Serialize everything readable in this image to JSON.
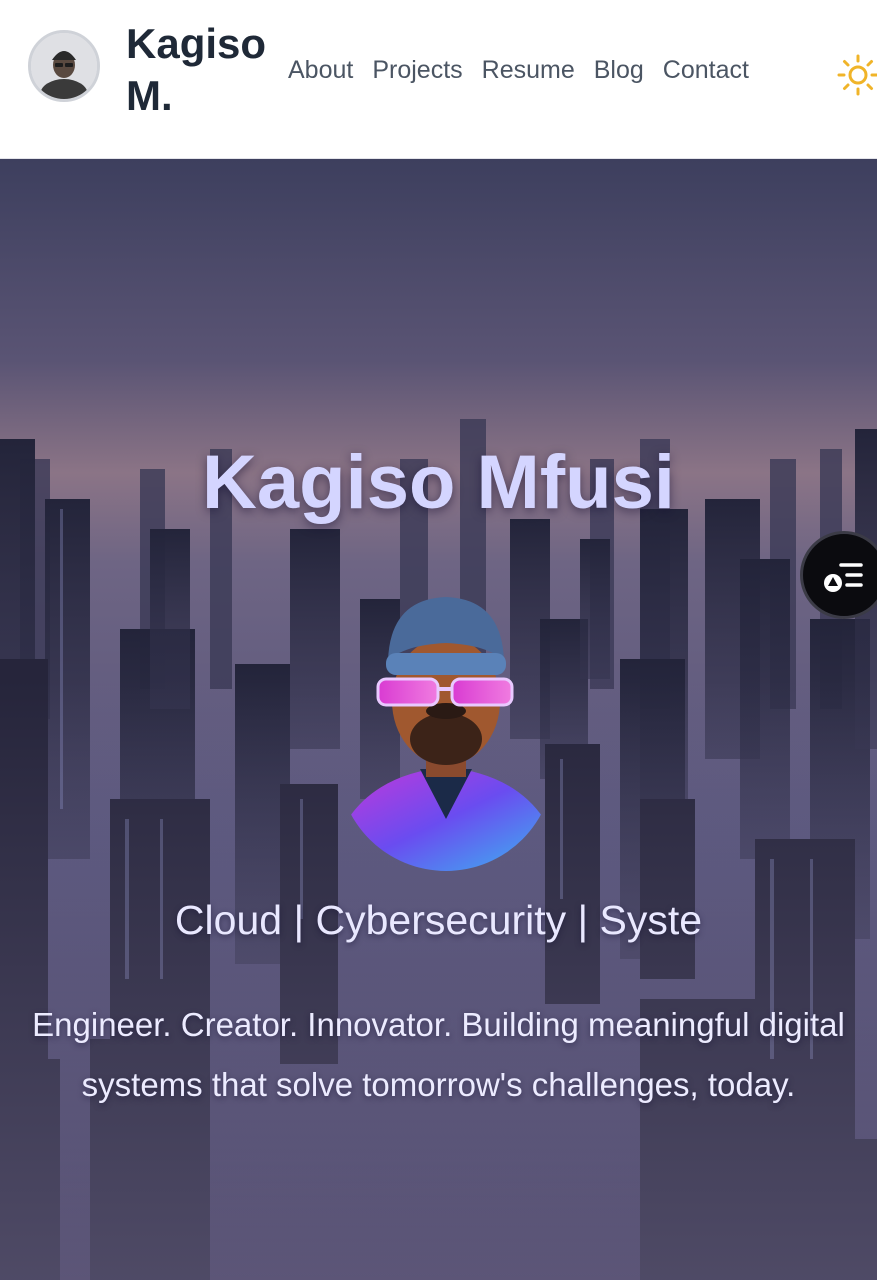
{
  "header": {
    "brand": "Kagiso M.",
    "nav": [
      "About",
      "Projects",
      "Resume",
      "Blog",
      "Contact"
    ],
    "theme_icon": "sun-icon",
    "accent_color": "#f0b429"
  },
  "hero": {
    "title": "Kagiso Mfusi",
    "subtitle": "Cloud | Cybersecurity | Syste",
    "tagline": "Engineer. Creator. Innovator. Building meaningful digital systems that solve tomorrow's challenges, today."
  },
  "floating_button": {
    "icon": "table-of-contents-icon"
  }
}
